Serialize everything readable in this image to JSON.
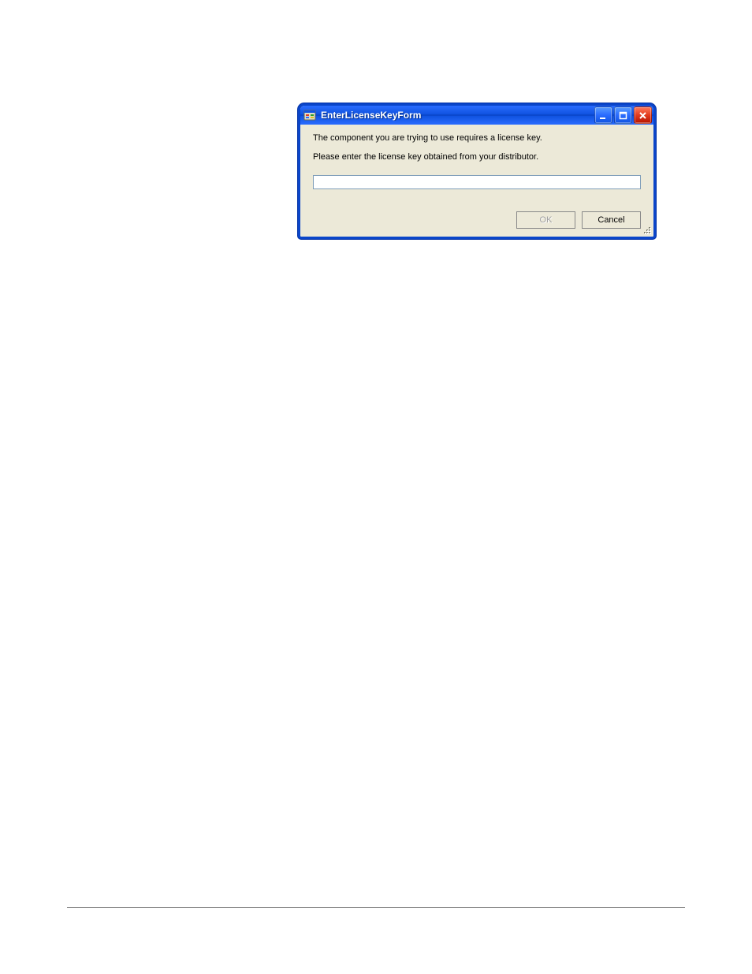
{
  "dialog": {
    "title": "EnterLicenseKeyForm",
    "message_line1": "The component you are trying to use requires a license key.",
    "message_line2": "Please enter the license key obtained from your distributor.",
    "input_value": "",
    "buttons": {
      "ok_label": "OK",
      "cancel_label": "Cancel",
      "ok_enabled": false
    },
    "icons": {
      "system": "app-icon",
      "minimize": "minimize-icon",
      "maximize": "maximize-icon",
      "close": "close-icon",
      "grip": "resize-grip-icon"
    }
  }
}
